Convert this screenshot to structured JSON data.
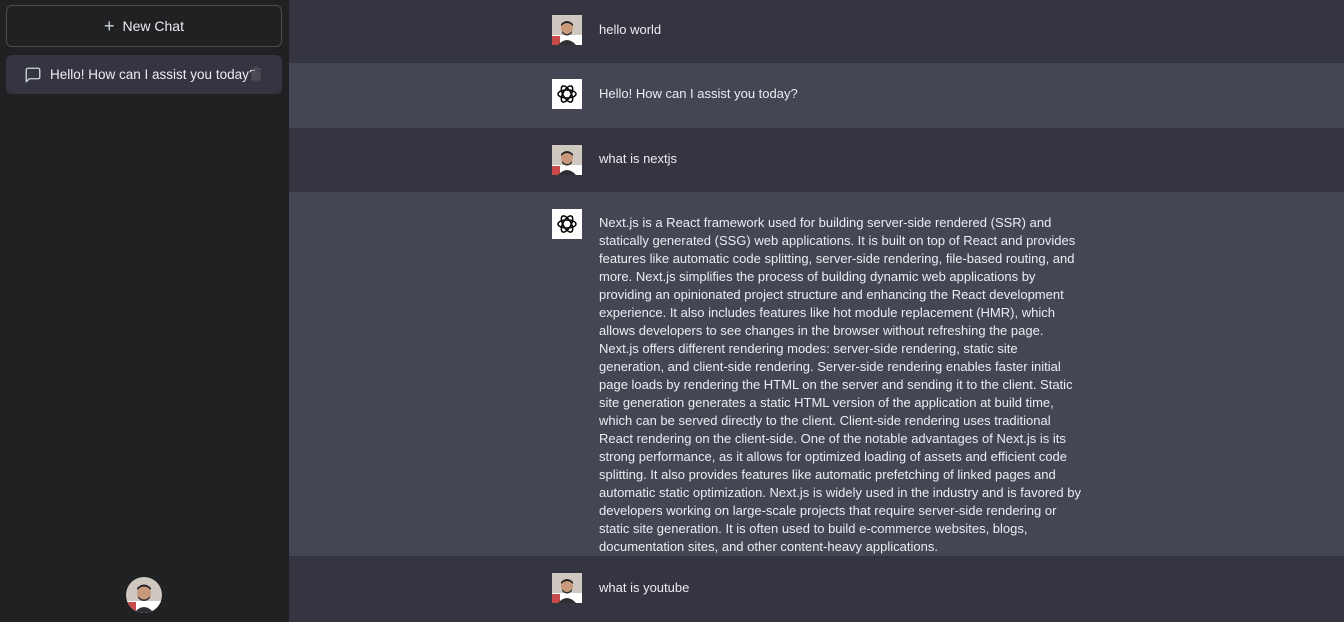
{
  "sidebar": {
    "new_chat_label": "New Chat",
    "history": [
      {
        "label": "Hello! How can I assist you today?"
      }
    ]
  },
  "messages": [
    {
      "role": "user",
      "text": "hello world"
    },
    {
      "role": "assistant",
      "text": "Hello! How can I assist you today?"
    },
    {
      "role": "user",
      "text": "what is nextjs"
    },
    {
      "role": "assistant",
      "text": "Next.js is a React framework used for building server-side rendered (SSR) and statically generated (SSG) web applications. It is built on top of React and provides features like automatic code splitting, server-side rendering, file-based routing, and more. Next.js simplifies the process of building dynamic web applications by providing an opinionated project structure and enhancing the React development experience. It also includes features like hot module replacement (HMR), which allows developers to see changes in the browser without refreshing the page. Next.js offers different rendering modes: server-side rendering, static site generation, and client-side rendering. Server-side rendering enables faster initial page loads by rendering the HTML on the server and sending it to the client. Static site generation generates a static HTML version of the application at build time, which can be served directly to the client. Client-side rendering uses traditional React rendering on the client-side. One of the notable advantages of Next.js is its strong performance, as it allows for optimized loading of assets and efficient code splitting. It also provides features like automatic prefetching of linked pages and automatic static optimization. Next.js is widely used in the industry and is favored by developers working on large-scale projects that require server-side rendering or static site generation. It is often used to build e-commerce websites, blogs, documentation sites, and other content-heavy applications."
    },
    {
      "role": "user",
      "text": "what is youtube"
    }
  ],
  "colors": {
    "sidebar_bg": "#202123",
    "user_row_bg": "#343541",
    "assistant_row_bg": "#444654",
    "text": "#ececf1"
  },
  "icons": {
    "new_chat": "plus-icon",
    "history_item": "message-icon",
    "delete": "trash-icon",
    "assistant_avatar": "openai-logo-icon",
    "user_avatar": "user-photo-avatar"
  }
}
